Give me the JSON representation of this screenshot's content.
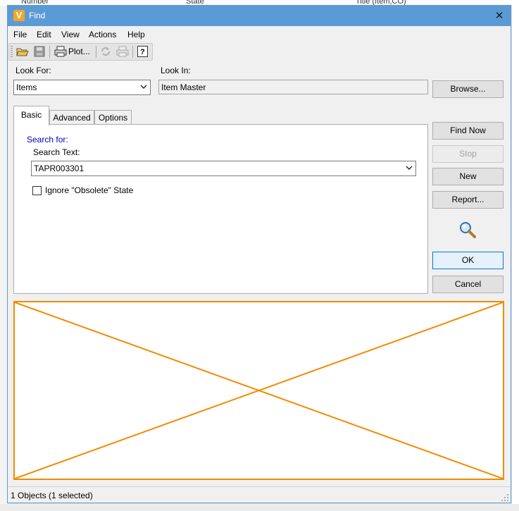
{
  "background": {
    "col_number": "Number",
    "col_state": "State",
    "col_title": "Title (Item,CO)"
  },
  "window": {
    "title": "Find",
    "close": "✕"
  },
  "menu": {
    "file": "File",
    "edit": "Edit",
    "view": "View",
    "actions": "Actions",
    "help": "Help"
  },
  "toolbar": {
    "plot_label": "Plot..."
  },
  "look_for": {
    "label": "Look For:",
    "value": "Items"
  },
  "look_in": {
    "label": "Look In:",
    "value": "Item Master"
  },
  "buttons": {
    "browse": "Browse...",
    "find_now": "Find Now",
    "stop": "Stop",
    "new": "New",
    "report": "Report...",
    "ok": "OK",
    "cancel": "Cancel"
  },
  "tabs": {
    "basic": "Basic",
    "advanced": "Advanced",
    "options": "Options"
  },
  "basic": {
    "search_for": "Search for:",
    "search_text_label": "Search Text:",
    "search_text_value": "TAPR003301",
    "ignore_obsolete": "Ignore \"Obsolete\" State",
    "ignore_obsolete_checked": false
  },
  "status": {
    "text": "1 Objects (1 selected)"
  },
  "colors": {
    "accent": "#5b9bd5",
    "preview_border": "#f08c00",
    "search_for_label": "#0000c0"
  }
}
